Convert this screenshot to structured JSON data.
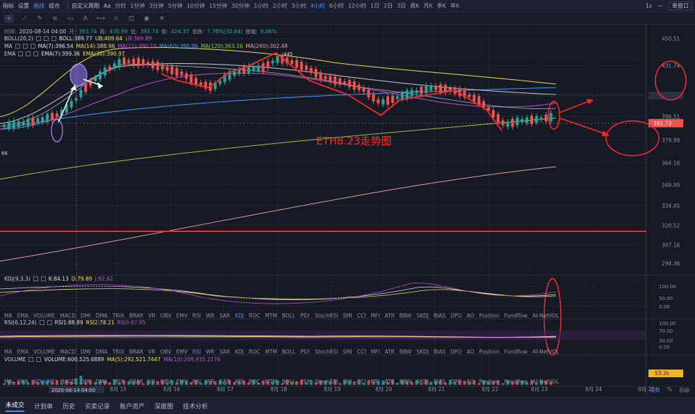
{
  "toolbar": {
    "items": [
      "指标",
      "设置",
      "画线",
      "组合",
      "自定义周期",
      "Aa"
    ],
    "timeframes": [
      "分时",
      "1分钟",
      "3分钟",
      "5分钟",
      "10分钟",
      "15分钟",
      "30分钟",
      "1小时",
      "2小时",
      "3小时",
      "4小时",
      "6小时",
      "12小时",
      "1日",
      "2日",
      "3日",
      "周K",
      "月K",
      "季K",
      "年K"
    ],
    "active_timeframe": "4小时",
    "right_items": [
      "1s"
    ],
    "single_window": "单窗口"
  },
  "legend": {
    "ohlc": {
      "time_label": "时间:",
      "time": "2020-08-14 04:00",
      "open_label": "开:",
      "open": "393.74",
      "high_label": "高:",
      "high": "430.99",
      "low_label": "低:",
      "low": "393.74",
      "close_label": "收:",
      "close": "424.37",
      "change_label": "涨跌:",
      "change": "7.78%(30.64)",
      "amp_label": "振幅:",
      "amp": "9.46%"
    },
    "boll": {
      "name": "BOLL(20,2)",
      "boll": "BOLL:389.77",
      "ub": "UB:409.64",
      "lb": "LB:369.89"
    },
    "ma": {
      "name": "MA",
      "ma7": "MA(7):396.54",
      "ma14": "MA(14):388.96",
      "ma21": "MA(21):390.10",
      "ma60": "MA(60):390.96",
      "ma120": "MA(120):363.16",
      "ma240": "MA(240):302.48"
    },
    "ema": {
      "name": "EMA",
      "ema7": "EMA(7):399.36",
      "ema30": "EMA(30):390.97"
    },
    "kdj": {
      "name": "KDJ(9,3,3)",
      "k": "K:84.13",
      "d": "D:79.89",
      "j": "J:92.62"
    },
    "rsi": {
      "name": "RSI(6,12,24)",
      "rsi1": "RSI1:88.89",
      "rsi2": "RSI2:78.21",
      "rsi3": "RSI3:67.95"
    },
    "volume": {
      "name": "VOLUME",
      "vol": "VOLUME:600,525.6889",
      "ma5": "MA(5):292,521.7447",
      "ma10": "MA(10):208,935.2176"
    }
  },
  "indicators": [
    "MA",
    "EMA",
    "VOLUME",
    "MACD",
    "DMI",
    "DMA",
    "TRIX",
    "BRAR",
    "VR",
    "OBV",
    "EMV",
    "RSI",
    "WR",
    "SAR",
    "KDJ",
    "ROC",
    "MTM",
    "BOLL",
    "PSY",
    "StochRSI",
    "SMI",
    "CCI",
    "MFI",
    "ATR",
    "BBW",
    "SKDJ",
    "BIAS",
    "DPO",
    "AO",
    "Position",
    "Fundflow",
    "AI-NetVOL",
    "LSUR",
    "BASIS",
    "TVolume",
    "FTBS",
    "TTSI",
    "TTMU",
    "AI-BSI",
    "MLR"
  ],
  "bottom_tabs": [
    "未成交",
    "计划单",
    "历史",
    "买卖记录",
    "账户资产",
    "深度图",
    "技术分析"
  ],
  "bottom_tools": [
    "对数",
    "%",
    "自动"
  ],
  "chart_data": {
    "type": "candlestick",
    "title": "ETH8.23走势图",
    "price_ticks": [
      450.51,
      431.74,
      410.59,
      396.51,
      379.99,
      364.16,
      348.99,
      334.45,
      320.52,
      307.16,
      294.36
    ],
    "current_price": "391.73",
    "left_edge_price_label": "66",
    "peak_label": "445",
    "kdj_ticks": [
      "100.00",
      "50.00",
      "0.00"
    ],
    "rsi_ticks": [
      "100.00",
      "70.00",
      "30.00",
      "0.00"
    ],
    "volume_last": "53.2k",
    "x_ticks": [
      "8月 15",
      "8月 16",
      "8月 17",
      "8月 18",
      "8月 19",
      "8月 20",
      "8月 21",
      "8月 22",
      "8月 23",
      "8月 24",
      "8月 25"
    ],
    "crosshair_date": "2020-08-14 04:00",
    "support_line": 316.5,
    "colors": {
      "up": "#26a69a",
      "down": "#ef5350",
      "annotation": "#ff2a2a",
      "purple": "#b18bff"
    }
  }
}
